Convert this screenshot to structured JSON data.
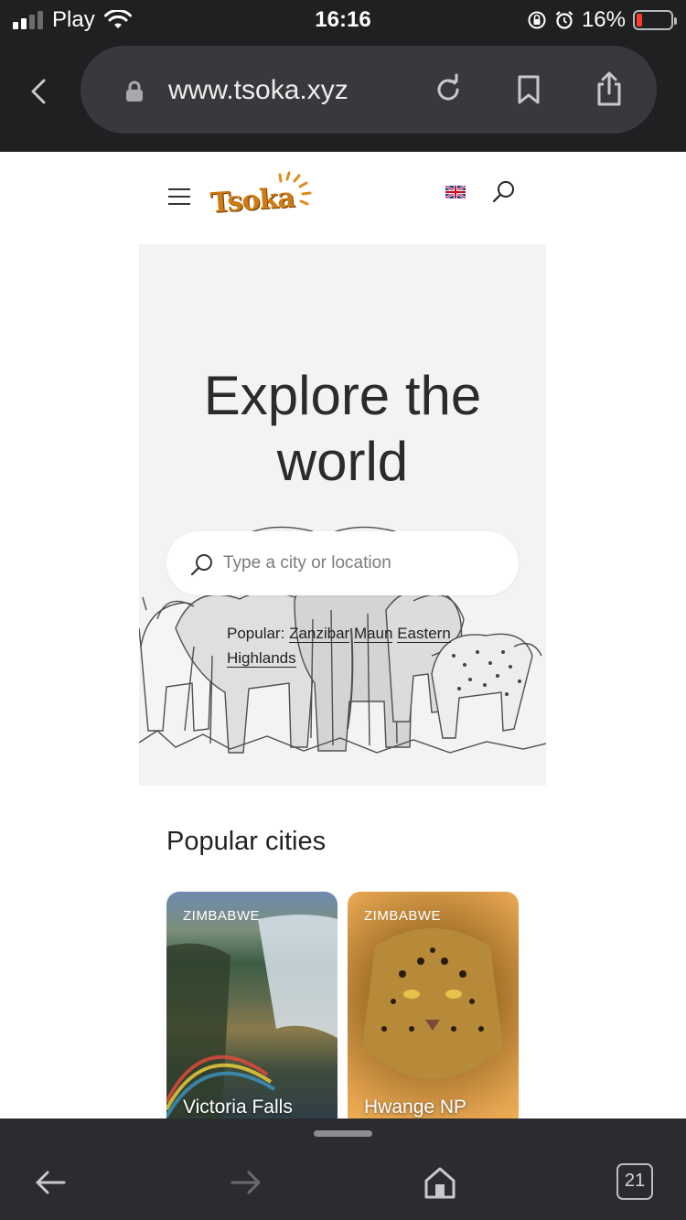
{
  "status_bar": {
    "carrier": "Play",
    "time": "16:16",
    "battery": "16%",
    "battery_level": 0.16,
    "icons": [
      "signal-icon",
      "wifi-icon",
      "rotation-lock-icon",
      "alarm-icon",
      "battery-icon"
    ]
  },
  "browser": {
    "url": "www.tsoka.xyz",
    "icons": [
      "back-chevron-icon",
      "lock-icon",
      "reload-icon",
      "bookmark-icon",
      "share-icon"
    ]
  },
  "site_header": {
    "logo_text": "Tsoka",
    "icons": [
      "hamburger-menu-icon",
      "uk-flag-icon",
      "search-icon"
    ]
  },
  "hero": {
    "title_line1": "Explore the",
    "title_line2": "world",
    "search_placeholder": "Type a city or location",
    "popular_label": "Popular:",
    "popular_items": [
      "Zanzibar",
      "Maun",
      "Eastern Highlands"
    ]
  },
  "popular_cities": {
    "title": "Popular cities",
    "cards": [
      {
        "country": "ZIMBABWE",
        "name": "Victoria Falls"
      },
      {
        "country": "ZIMBABWE",
        "name": "Hwange NP"
      }
    ]
  },
  "bottom_bar": {
    "tab_count": "21",
    "icons": [
      "back-arrow-icon",
      "forward-arrow-icon",
      "home-icon",
      "tabs-icon"
    ]
  },
  "colors": {
    "browser_chrome": "#1f2022",
    "url_bar": "#38393c",
    "hero_bg": "#f3f3f3",
    "logo_orange": "#d07a12",
    "battery_low": "#ff3b30"
  }
}
